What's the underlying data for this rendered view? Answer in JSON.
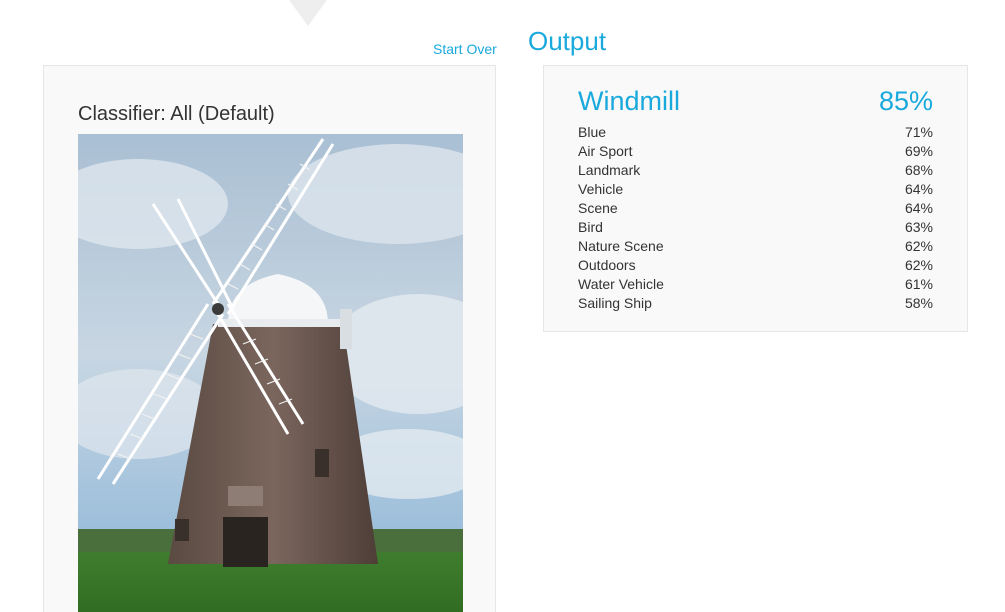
{
  "header": {
    "start_over_label": "Start Over",
    "output_title": "Output"
  },
  "input": {
    "classifier_label": "Classifier: All (Default)",
    "image_description_icon": "windmill-photo"
  },
  "output": {
    "top_result": {
      "label": "Windmill",
      "score": "85%"
    },
    "results": [
      {
        "label": "Blue",
        "score": "71%"
      },
      {
        "label": "Air Sport",
        "score": "69%"
      },
      {
        "label": "Landmark",
        "score": "68%"
      },
      {
        "label": "Vehicle",
        "score": "64%"
      },
      {
        "label": "Scene",
        "score": "64%"
      },
      {
        "label": "Bird",
        "score": "63%"
      },
      {
        "label": "Nature Scene",
        "score": "62%"
      },
      {
        "label": "Outdoors",
        "score": "62%"
      },
      {
        "label": "Water Vehicle",
        "score": "61%"
      },
      {
        "label": "Sailing Ship",
        "score": "58%"
      }
    ]
  },
  "colors": {
    "accent": "#1aa9dc",
    "panel_bg": "#f9f9f9",
    "panel_border": "#e6e6e6",
    "text": "#333333"
  }
}
